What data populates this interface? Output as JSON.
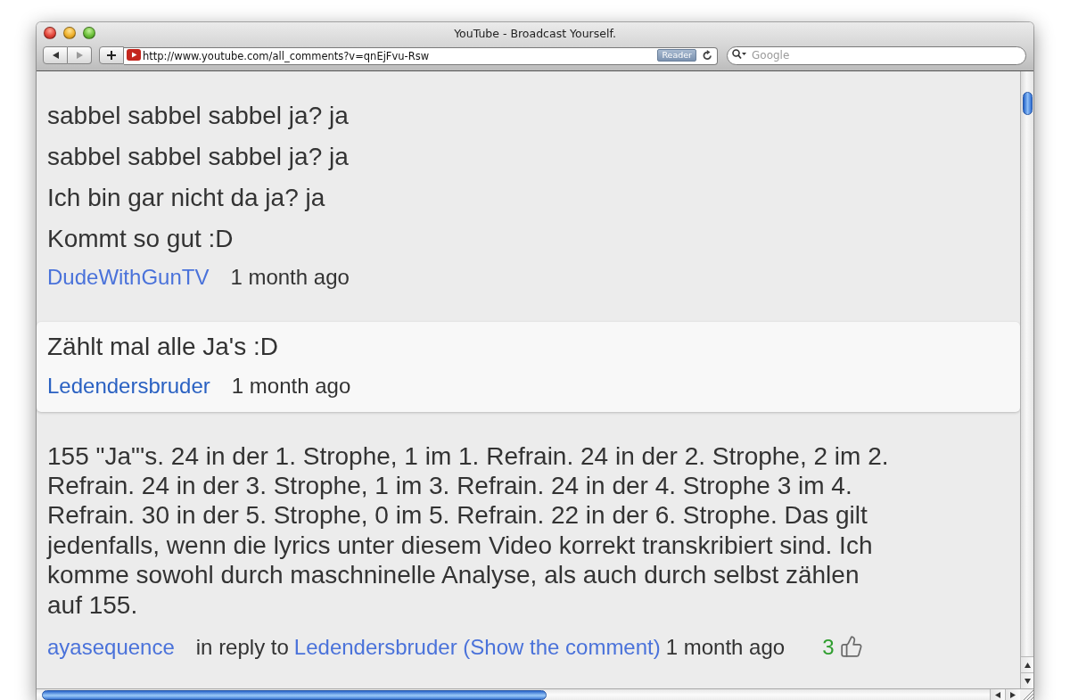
{
  "window": {
    "title": "YouTube - Broadcast Yourself."
  },
  "toolbar": {
    "address": "http://www.youtube.com/all_comments?v=qnEjFvu-Rsw",
    "reader": "Reader",
    "search": {
      "placeholder": "Google"
    }
  },
  "comments": [
    {
      "kind": "plain",
      "lines": [
        "sabbel sabbel sabbel ja? ja",
        "sabbel sabbel sabbel ja? ja",
        "Ich bin gar nicht da ja? ja",
        "Kommt so gut :D"
      ],
      "author": "DudeWithGunTV",
      "time": "1 month ago"
    },
    {
      "kind": "highlighted",
      "lines": [
        "Zählt mal alle Ja's :D"
      ],
      "author": "Ledendersbruder",
      "time": "1 month ago"
    },
    {
      "kind": "reply",
      "lines": [
        "155 \"Ja\"'s. 24 in der 1. Strophe, 1 im 1. Refrain. 24 in der 2. Strophe, 2 im 2. Refrain. 24 in der 3. Strophe, 1 im 3. Refrain. 24 in der 4. Strophe 3 im 4. Refrain. 30 in der 5. Strophe, 0 im 5. Refrain. 22 in der 6. Strophe. Das gilt jedenfalls, wenn die lyrics unter diesem Video korrekt transkribiert sind. Ich komme sowohl durch maschninelle Analyse, als auch durch selbst zählen auf 155."
      ],
      "author": "ayasequence",
      "reply_label": "in reply to",
      "reply_link": "Ledendersbruder (Show the comment)",
      "time": "1 month ago",
      "likes": "3"
    }
  ]
}
